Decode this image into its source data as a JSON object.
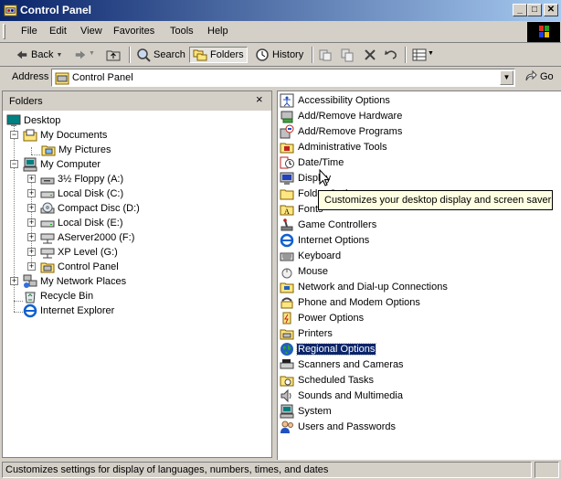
{
  "window": {
    "title": "Control Panel",
    "buttons": {
      "minimize": "_",
      "maximize": "□",
      "close": "✕"
    }
  },
  "menubar": {
    "items": [
      "File",
      "Edit",
      "View",
      "Favorites",
      "Tools",
      "Help"
    ]
  },
  "toolbar": {
    "back_label": "Back",
    "search_label": "Search",
    "folders_label": "Folders",
    "history_label": "History"
  },
  "address": {
    "label": "Address",
    "value": "Control Panel",
    "go_label": "Go"
  },
  "folders_pane": {
    "title": "Folders",
    "close_glyph": "×",
    "tree": [
      {
        "label": "Desktop",
        "icon": "desktop-icon"
      },
      {
        "label": "My Documents",
        "icon": "documents-folder-icon"
      },
      {
        "label": "My Pictures",
        "icon": "pictures-folder-icon"
      },
      {
        "label": "My Computer",
        "icon": "computer-icon"
      },
      {
        "label": "3½ Floppy (A:)",
        "icon": "floppy-drive-icon"
      },
      {
        "label": "Local Disk (C:)",
        "icon": "hard-drive-icon"
      },
      {
        "label": "Compact Disc (D:)",
        "icon": "cd-drive-icon"
      },
      {
        "label": "Local Disk (E:)",
        "icon": "hard-drive-icon"
      },
      {
        "label": "AServer2000 (F:)",
        "icon": "network-drive-icon"
      },
      {
        "label": "XP Level (G:)",
        "icon": "network-drive-icon"
      },
      {
        "label": "Control Panel",
        "icon": "control-panel-icon"
      },
      {
        "label": "My Network Places",
        "icon": "network-places-icon"
      },
      {
        "label": "Recycle Bin",
        "icon": "recycle-bin-icon"
      },
      {
        "label": "Internet Explorer",
        "icon": "internet-explorer-icon"
      }
    ]
  },
  "content": {
    "items": [
      {
        "label": "Accessibility Options",
        "icon": "accessibility-icon"
      },
      {
        "label": "Add/Remove Hardware",
        "icon": "add-hardware-icon"
      },
      {
        "label": "Add/Remove Programs",
        "icon": "add-programs-icon"
      },
      {
        "label": "Administrative Tools",
        "icon": "admin-tools-icon"
      },
      {
        "label": "Date/Time",
        "icon": "datetime-icon"
      },
      {
        "label": "Display",
        "icon": "display-icon"
      },
      {
        "label": "Folder Options",
        "icon": "folder-options-icon"
      },
      {
        "label": "Fonts",
        "icon": "fonts-icon"
      },
      {
        "label": "Game Controllers",
        "icon": "game-controllers-icon"
      },
      {
        "label": "Internet Options",
        "icon": "internet-options-icon"
      },
      {
        "label": "Keyboard",
        "icon": "keyboard-icon"
      },
      {
        "label": "Mouse",
        "icon": "mouse-icon"
      },
      {
        "label": "Network and Dial-up Connections",
        "icon": "network-connections-icon"
      },
      {
        "label": "Phone and Modem Options",
        "icon": "phone-modem-icon"
      },
      {
        "label": "Power Options",
        "icon": "power-options-icon"
      },
      {
        "label": "Printers",
        "icon": "printers-icon"
      },
      {
        "label": "Regional Options",
        "icon": "regional-options-icon",
        "selected": true
      },
      {
        "label": "Scanners and Cameras",
        "icon": "scanners-icon"
      },
      {
        "label": "Scheduled Tasks",
        "icon": "scheduled-tasks-icon"
      },
      {
        "label": "Sounds and Multimedia",
        "icon": "sounds-icon"
      },
      {
        "label": "System",
        "icon": "system-icon"
      },
      {
        "label": "Users and Passwords",
        "icon": "users-icon"
      }
    ],
    "tooltip": "Customizes your desktop display and screen saver"
  },
  "statusbar": {
    "text": "Customizes settings for display of languages, numbers, times, and dates"
  },
  "colors": {
    "titlebar_start": "#0a246a",
    "titlebar_end": "#a6caf0",
    "selection": "#0a246a",
    "face": "#d4d0c8",
    "tooltip_bg": "#ffffe1"
  }
}
